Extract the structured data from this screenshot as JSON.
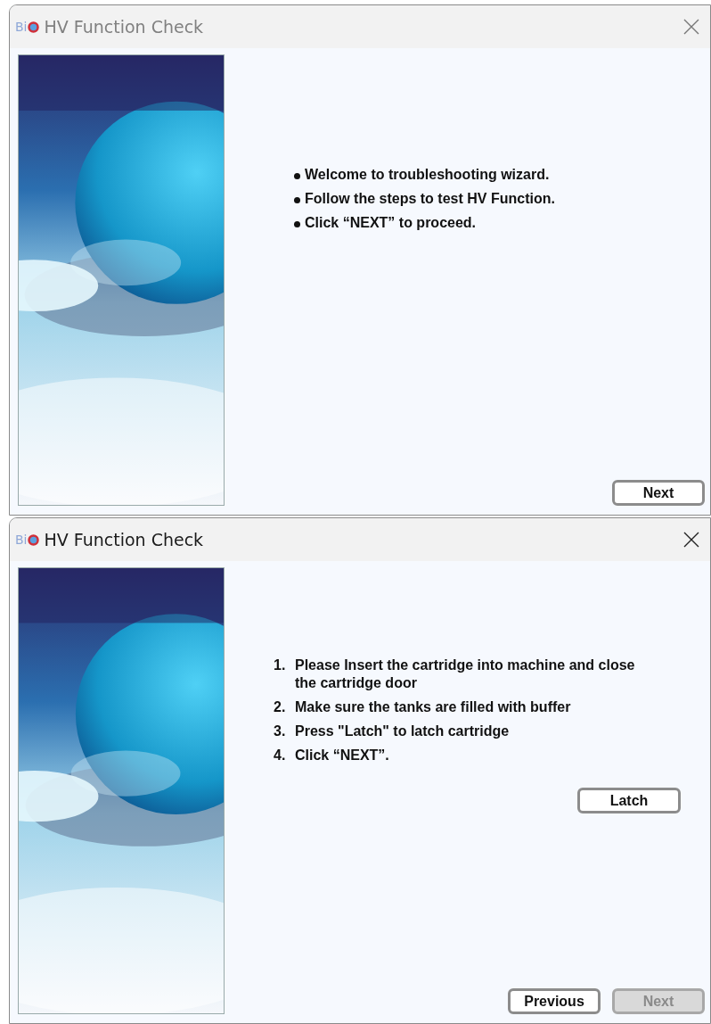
{
  "windows": [
    {
      "logo_text": "Bi",
      "title": "HV Function Check",
      "active": false,
      "kind": "bullets",
      "items": [
        {
          "text": "Welcome to troubleshooting wizard."
        },
        {
          "text": "Follow the steps to test HV Function."
        },
        {
          "text": "Click “NEXT” to proceed."
        }
      ],
      "buttons": [
        {
          "label": "Next",
          "disabled": false
        }
      ]
    },
    {
      "logo_text": "Bi",
      "title": "HV Function Check",
      "active": true,
      "kind": "numbered",
      "items": [
        {
          "number": "1.",
          "text": "Please Insert the cartridge into machine and close the cartridge door"
        },
        {
          "number": "2.",
          "text": "Make sure the tanks are filled with buffer"
        },
        {
          "number": "3.",
          "text": "Press \"Latch\" to latch cartridge"
        },
        {
          "number": "4.",
          "text": "Click “NEXT”."
        }
      ],
      "action_button": {
        "label": "Latch",
        "disabled": false
      },
      "buttons": [
        {
          "label": "Previous",
          "disabled": false
        },
        {
          "label": "Next",
          "disabled": true
        }
      ]
    }
  ]
}
